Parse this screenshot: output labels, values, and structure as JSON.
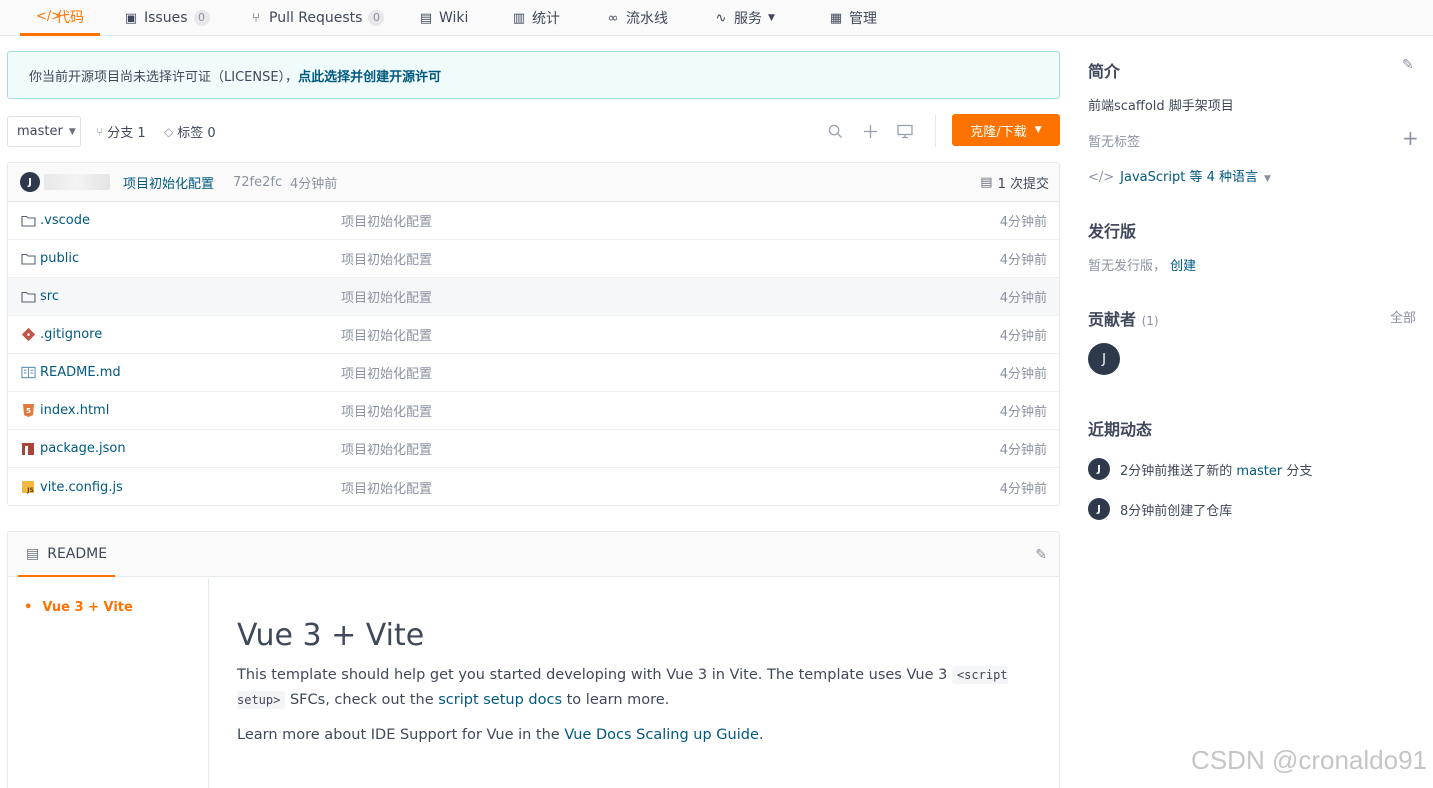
{
  "nav": {
    "tabs": [
      {
        "label": "代码",
        "icon": "code-icon"
      },
      {
        "label": "Issues",
        "count": "0",
        "icon": "issues-icon"
      },
      {
        "label": "Pull Requests",
        "count": "0",
        "icon": "pull-request-icon"
      },
      {
        "label": "Wiki",
        "icon": "wiki-icon"
      },
      {
        "label": "统计",
        "icon": "stats-icon"
      },
      {
        "label": "流水线",
        "icon": "pipeline-icon"
      },
      {
        "label": "服务",
        "icon": "service-icon"
      },
      {
        "label": "管理",
        "icon": "manage-icon"
      }
    ],
    "active_tab": "代码"
  },
  "banner": {
    "text": "你当前开源项目尚未选择许可证（LICENSE），",
    "link": "点此选择并创建开源许可"
  },
  "toolbar": {
    "branch": "master",
    "branches": "分支 1",
    "tags": "标签 0",
    "clone_label": "克隆/下载"
  },
  "commit": {
    "avatar": "J",
    "message": "项目初始化配置",
    "sha": "72fe2fc",
    "time": "4分钟前",
    "count_label": "1 次提交"
  },
  "files": [
    {
      "name": ".vscode",
      "type": "folder",
      "icon": "folder-icon",
      "message": "项目初始化配置",
      "time": "4分钟前"
    },
    {
      "name": "public",
      "type": "folder",
      "icon": "folder-icon",
      "message": "项目初始化配置",
      "time": "4分钟前"
    },
    {
      "name": "src",
      "type": "folder",
      "icon": "folder-icon",
      "message": "项目初始化配置",
      "time": "4分钟前"
    },
    {
      "name": ".gitignore",
      "type": "file",
      "icon": "git-file-icon",
      "message": "项目初始化配置",
      "time": "4分钟前"
    },
    {
      "name": "README.md",
      "type": "file",
      "icon": "readme-file-icon",
      "message": "项目初始化配置",
      "time": "4分钟前"
    },
    {
      "name": "index.html",
      "type": "file",
      "icon": "html5-file-icon",
      "message": "项目初始化配置",
      "time": "4分钟前"
    },
    {
      "name": "package.json",
      "type": "file",
      "icon": "npm-file-icon",
      "message": "项目初始化配置",
      "time": "4分钟前"
    },
    {
      "name": "vite.config.js",
      "type": "file",
      "icon": "js-file-icon",
      "message": "项目初始化配置",
      "time": "4分钟前"
    }
  ],
  "readme": {
    "tab_label": "README",
    "toc": [
      "Vue 3 + Vite"
    ],
    "title": "Vue 3 + Vite",
    "p1_a": "This template should help get you started developing with Vue 3 in Vite. The template uses Vue 3 ",
    "p1_code": "<script setup>",
    "p1_b": " SFCs, check out the ",
    "p1_link": "script setup docs",
    "p1_c": " to learn more.",
    "p2_a": "Learn more about IDE Support for Vue in the ",
    "p2_link": "Vue Docs Scaling up Guide",
    "p2_b": "."
  },
  "sidebar": {
    "intro_title": "简介",
    "intro_desc": "前端scaffold 脚手架项目",
    "no_tags": "暂无标签",
    "languages": "JavaScript 等 4 种语言",
    "release_title": "发行版",
    "no_release": "暂无发行版，",
    "create_link": "创建",
    "contributors_title": "贡献者",
    "contributors_count": "(1)",
    "all_label": "全部",
    "contributor_avatar": "J",
    "activity_title": "近期动态",
    "activities": [
      {
        "avatar": "J",
        "pre": "2分钟前推送了新的 ",
        "link": "master",
        "post": " 分支"
      },
      {
        "avatar": "J",
        "pre": "8分钟前创建了仓库",
        "link": "",
        "post": ""
      }
    ]
  },
  "watermark": "CSDN @cronaldo91"
}
